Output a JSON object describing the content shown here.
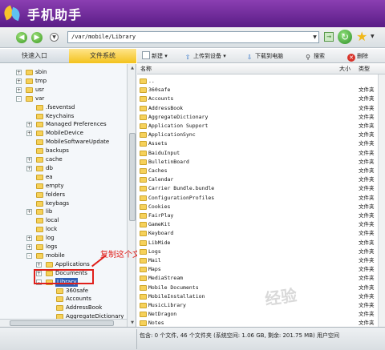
{
  "app": {
    "title": "手机助手"
  },
  "nav": {
    "address": "/var/mobile/Library",
    "back_icon": "back-arrow-icon",
    "forward_icon": "forward-arrow-icon"
  },
  "tabs": [
    {
      "label": "快速入口"
    },
    {
      "label": "文件系统"
    }
  ],
  "toolbar": {
    "new_label": "新建",
    "upload_label": "上传到设备",
    "download_label": "下载到电脑",
    "search_label": "搜索",
    "delete_label": "删除"
  },
  "tree": [
    {
      "label": "sbin",
      "depth": 1,
      "expander": "+"
    },
    {
      "label": "tmp",
      "depth": 1,
      "expander": "+"
    },
    {
      "label": "usr",
      "depth": 1,
      "expander": "+"
    },
    {
      "label": "var",
      "depth": 1,
      "expander": "-"
    },
    {
      "label": ".fseventsd",
      "depth": 2,
      "expander": ""
    },
    {
      "label": "Keychains",
      "depth": 2,
      "expander": ""
    },
    {
      "label": "Managed Preferences",
      "depth": 2,
      "expander": "+"
    },
    {
      "label": "MobileDevice",
      "depth": 2,
      "expander": "+"
    },
    {
      "label": "MobileSoftwareUpdate",
      "depth": 2,
      "expander": ""
    },
    {
      "label": "backups",
      "depth": 2,
      "expander": ""
    },
    {
      "label": "cache",
      "depth": 2,
      "expander": "+"
    },
    {
      "label": "db",
      "depth": 2,
      "expander": "+"
    },
    {
      "label": "ea",
      "depth": 2,
      "expander": ""
    },
    {
      "label": "empty",
      "depth": 2,
      "expander": ""
    },
    {
      "label": "folders",
      "depth": 2,
      "expander": ""
    },
    {
      "label": "keybags",
      "depth": 2,
      "expander": ""
    },
    {
      "label": "lib",
      "depth": 2,
      "expander": "+"
    },
    {
      "label": "local",
      "depth": 2,
      "expander": ""
    },
    {
      "label": "lock",
      "depth": 2,
      "expander": ""
    },
    {
      "label": "log",
      "depth": 2,
      "expander": "+"
    },
    {
      "label": "logs",
      "depth": 2,
      "expander": "+"
    },
    {
      "label": "mobile",
      "depth": 2,
      "expander": "-"
    },
    {
      "label": "Applications",
      "depth": 3,
      "expander": "+"
    },
    {
      "label": "Documents",
      "depth": 3,
      "expander": "+"
    },
    {
      "label": "Library",
      "depth": 3,
      "expander": "-"
    },
    {
      "label": "360safe",
      "depth": 4,
      "expander": ""
    },
    {
      "label": "Accounts",
      "depth": 4,
      "expander": ""
    },
    {
      "label": "AddressBook",
      "depth": 4,
      "expander": ""
    },
    {
      "label": "AggregateDictionary",
      "depth": 4,
      "expander": ""
    },
    {
      "label": "Application Support",
      "depth": 4,
      "expander": ""
    }
  ],
  "annotation": "复制这个文件夹到桌面",
  "list": {
    "col_name": "名称",
    "col_size": "大小",
    "col_type": "类型",
    "rows": [
      {
        "name": "..",
        "type": ""
      },
      {
        "name": "360safe",
        "type": "文件夹"
      },
      {
        "name": "Accounts",
        "type": "文件夹"
      },
      {
        "name": "AddressBook",
        "type": "文件夹"
      },
      {
        "name": "AggregateDictionary",
        "type": "文件夹"
      },
      {
        "name": "Application Support",
        "type": "文件夹"
      },
      {
        "name": "ApplicationSync",
        "type": "文件夹"
      },
      {
        "name": "Assets",
        "type": "文件夹"
      },
      {
        "name": "BaiduInput",
        "type": "文件夹"
      },
      {
        "name": "BulletinBoard",
        "type": "文件夹"
      },
      {
        "name": "Caches",
        "type": "文件夹"
      },
      {
        "name": "Calendar",
        "type": "文件夹"
      },
      {
        "name": "Carrier Bundle.bundle",
        "type": "文件夹"
      },
      {
        "name": "ConfigurationProfiles",
        "type": "文件夹"
      },
      {
        "name": "Cookies",
        "type": "文件夹"
      },
      {
        "name": "FairPlay",
        "type": "文件夹"
      },
      {
        "name": "GameKit",
        "type": "文件夹"
      },
      {
        "name": "Keyboard",
        "type": "文件夹"
      },
      {
        "name": "LibMide",
        "type": "文件夹"
      },
      {
        "name": "Logs",
        "type": "文件夹"
      },
      {
        "name": "Mail",
        "type": "文件夹"
      },
      {
        "name": "Maps",
        "type": "文件夹"
      },
      {
        "name": "MediaStream",
        "type": "文件夹"
      },
      {
        "name": "Mobile Documents",
        "type": "文件夹"
      },
      {
        "name": "MobileInstallation",
        "type": "文件夹"
      },
      {
        "name": "MusicLibrary",
        "type": "文件夹"
      },
      {
        "name": "NetDragon",
        "type": "文件夹"
      },
      {
        "name": "Notes",
        "type": "文件夹"
      }
    ]
  },
  "status": {
    "text": "包含: 0 个文件, 46 个文件夹   (系统空间: 1.06 GB, 剩余: 201.75 MB)  用户空间"
  },
  "watermark": "经验"
}
